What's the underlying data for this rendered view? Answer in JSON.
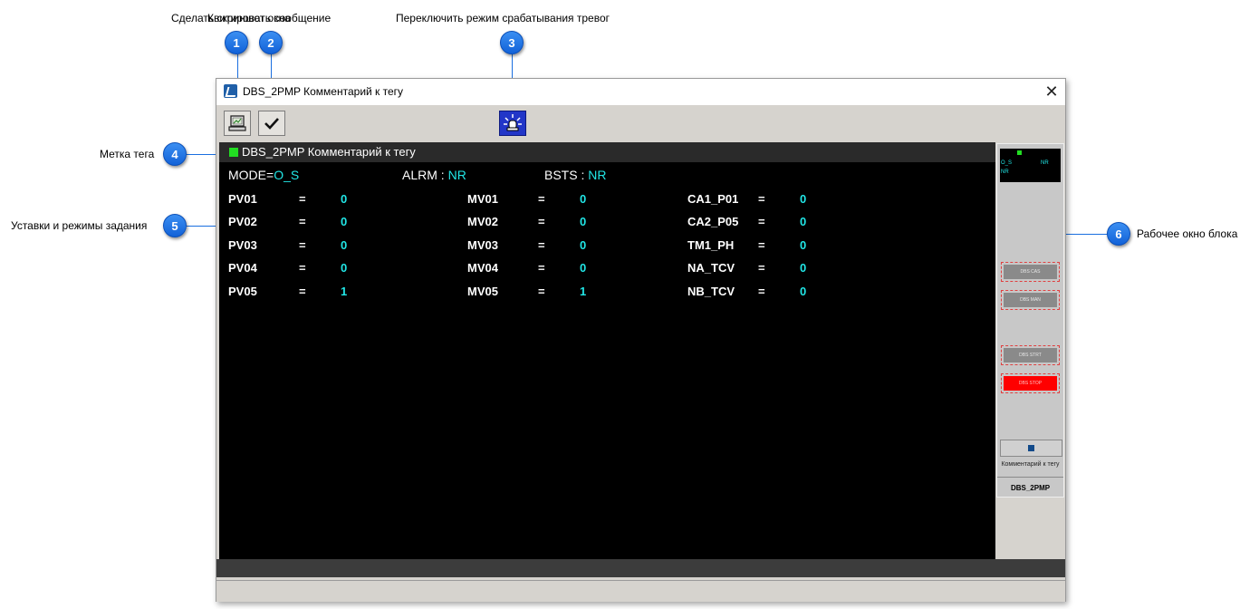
{
  "annotations": {
    "a1": {
      "num": "1",
      "label": "Сделать скриншот окна"
    },
    "a2": {
      "num": "2",
      "label": "Квитировать сообщение"
    },
    "a3": {
      "num": "3",
      "label": "Переключить режим срабатывания тревог"
    },
    "a4": {
      "num": "4",
      "label": "Метка тега"
    },
    "a5": {
      "num": "5",
      "label": "Уставки и режимы задания"
    },
    "a6": {
      "num": "6",
      "label": "Рабочее окно блока"
    }
  },
  "window": {
    "title": "DBS_2PMP Комментарий к тегу",
    "close": "✕"
  },
  "toolbar": {
    "screenshot_icon": "screenshot-icon",
    "ack_icon": "checkmark-icon",
    "alarm_icon": "alarm-siren-icon"
  },
  "panel": {
    "title": "DBS_2PMP Комментарий к тегу",
    "tagmark_color": "#22dd22",
    "mode_label": "MODE=",
    "mode_value": "O_S",
    "alrm_label": "ALRM :",
    "alrm_value": "NR",
    "bsts_label": "BSTS :",
    "bsts_value": "NR",
    "rows": [
      {
        "c1": "PV01",
        "v1": "0",
        "c2": "MV01",
        "v2": "0",
        "c3": "CA1_P01",
        "v3": "0"
      },
      {
        "c1": "PV02",
        "v1": "0",
        "c2": "MV02",
        "v2": "0",
        "c3": "CA2_P05",
        "v3": "0"
      },
      {
        "c1": "PV03",
        "v1": "0",
        "c2": "MV03",
        "v2": "0",
        "c3": "TM1_PH",
        "v3": "0"
      },
      {
        "c1": "PV04",
        "v1": "0",
        "c2": "MV04",
        "v2": "0",
        "c3": "NA_TCV",
        "v3": "0"
      },
      {
        "c1": "PV05",
        "v1": "1",
        "c2": "MV05",
        "v2": "1",
        "c3": "NB_TCV",
        "v3": "0"
      }
    ],
    "eq": "="
  },
  "block": {
    "mini_mode": "O_S",
    "mini_alrm": "NR",
    "mini_bsts": "NR",
    "btn_cas": "DBS CAS",
    "btn_man": "DBS MAN",
    "btn_strt": "DBS STRT",
    "btn_stop": "DBS STOP",
    "comment": "Комментарий к тегу",
    "name": "DBS_2PMP"
  },
  "colors": {
    "accent": "#1a6fe0",
    "value": "#21e6e6",
    "stop": "#ff0000"
  }
}
